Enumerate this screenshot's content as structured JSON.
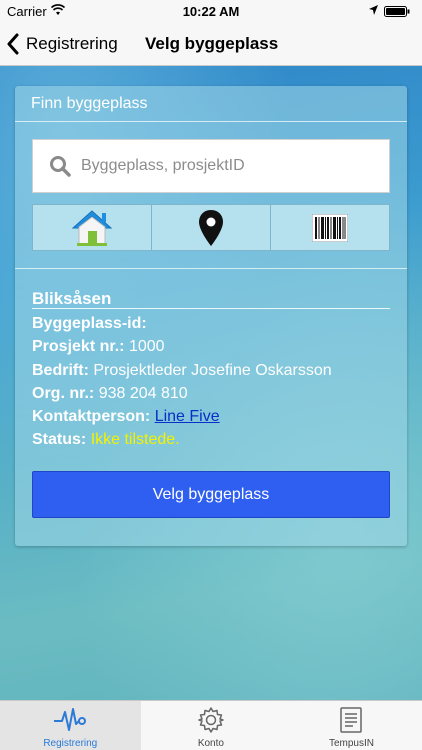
{
  "status_bar": {
    "carrier": "Carrier",
    "time": "10:22 AM"
  },
  "nav": {
    "back_label": "Registrering",
    "title": "Velg byggeplass"
  },
  "panel": {
    "header": "Finn byggeplass",
    "search_placeholder": "Byggeplass, prosjektID",
    "icon_buttons": [
      "home-icon",
      "location-pin-icon",
      "barcode-icon"
    ]
  },
  "site": {
    "name": "Bliksåsen",
    "site_id_label": "Byggeplass-id",
    "site_id_value": "",
    "project_label": "Prosjekt nr.",
    "project_value": "1000",
    "company_label": "Bedrift",
    "company_value": "Prosjektleder Josefine Oskarsson",
    "org_label": "Org. nr.",
    "org_value": "938 204 810",
    "contact_label": "Kontaktperson",
    "contact_value": "Line Five",
    "status_label": "Status",
    "status_value": "Ikke tilstede."
  },
  "select_button": "Velg byggeplass",
  "tabs": [
    {
      "label": "Registrering",
      "icon": "pulse-icon",
      "active": true
    },
    {
      "label": "Konto",
      "icon": "gear-icon",
      "active": false
    },
    {
      "label": "TempusIN",
      "icon": "document-icon",
      "active": false
    }
  ],
  "colors": {
    "link": "#0a2ec8",
    "status_warning": "#f2f200",
    "button": "#2f5ff0",
    "tab_active": "#2a7ad6"
  }
}
